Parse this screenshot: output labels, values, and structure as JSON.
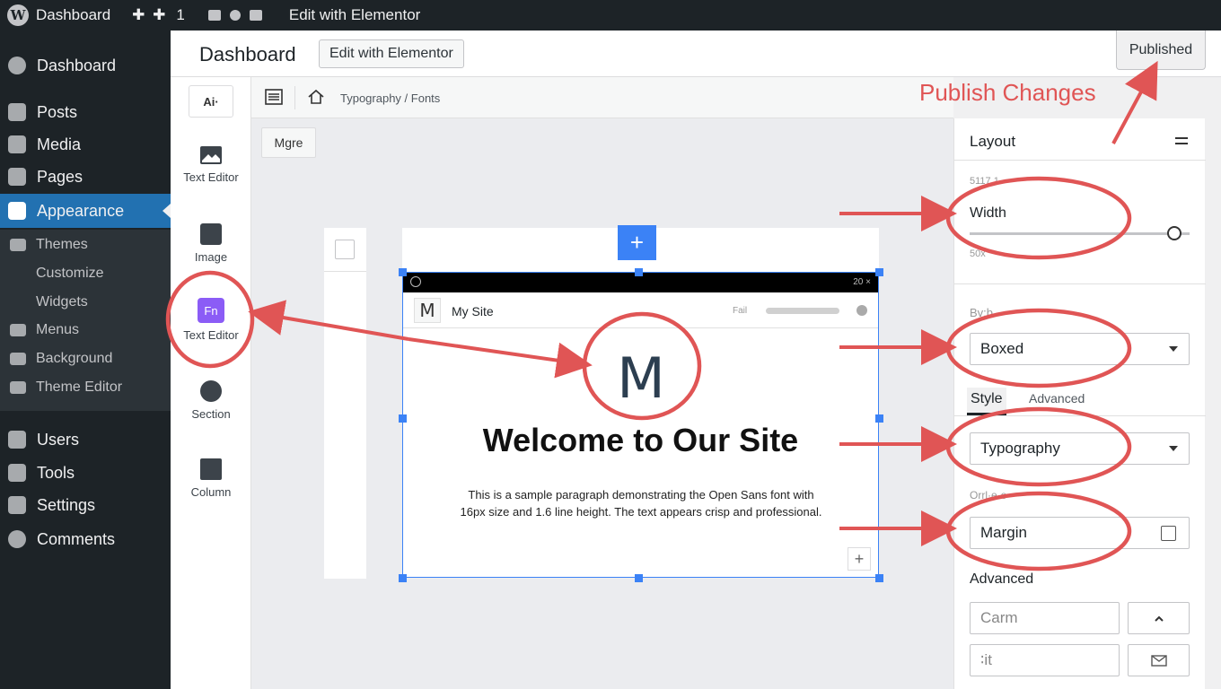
{
  "adminbar": {
    "site": "Dashboard",
    "new_icons": "✚ ✚",
    "updates": "1",
    "edit": "Edit with Elementor",
    "wp_logo": "W"
  },
  "menu": {
    "items": [
      {
        "label": "Dashboard",
        "icon": "dashboard-icon"
      },
      {
        "label": "Posts",
        "icon": "pin-icon"
      },
      {
        "label": "Media",
        "icon": "media-icon"
      },
      {
        "label": "Pages",
        "icon": "pages-icon"
      },
      {
        "label": "Appearance",
        "icon": "paintbrush-icon"
      },
      {
        "label": "Users",
        "icon": "users-icon"
      },
      {
        "label": "Tools",
        "icon": "tools-icon"
      },
      {
        "label": "Settings",
        "icon": "settings-icon"
      },
      {
        "label": "Comments",
        "icon": "comments-icon"
      }
    ],
    "sub": [
      "Themes",
      "Customize",
      "Widgets",
      "Menus",
      "Background",
      "Theme Editor"
    ]
  },
  "header": {
    "title": "Dashboard",
    "edit_button": "Edit with Elementor",
    "published": "Published"
  },
  "widgets": {
    "ai": "Ai·",
    "items": [
      "Text Editor",
      "Image",
      "Text Editor",
      "Section",
      "Column"
    ],
    "fn": "Fn"
  },
  "toolbar": {
    "breadcrumb": "Typography / Fonts"
  },
  "canvas": {
    "more": "Mgre",
    "add": "+"
  },
  "preview": {
    "status_time": "20 ×",
    "logo": "M",
    "site_name": "My Site",
    "fail": "Fail",
    "big_logo": "M",
    "heading": "Welcome to Our Site",
    "paragraph": "This is a sample paragraph demonstrating the Open Sans font with 16px size and 1.6 line height. The text appears crisp and professional.",
    "add": "+"
  },
  "panel": {
    "title": "Layout",
    "faint1": "5117.1 ·",
    "width_label": "Width",
    "width_value": 0.93,
    "faint2": "50x",
    "faint3": "Bv:b",
    "layout_select": "Boxed",
    "tab_style": "Style",
    "tab_advanced": "Advanced",
    "typography_select": "Typography",
    "faint4": "Orrl·e·e",
    "margin_label": "Margin",
    "advanced_label": "Advanced",
    "input1": "Carm",
    "input2": "∶it"
  },
  "annotations": {
    "publish_label": "Publish Changes",
    "color": "#e05555"
  }
}
